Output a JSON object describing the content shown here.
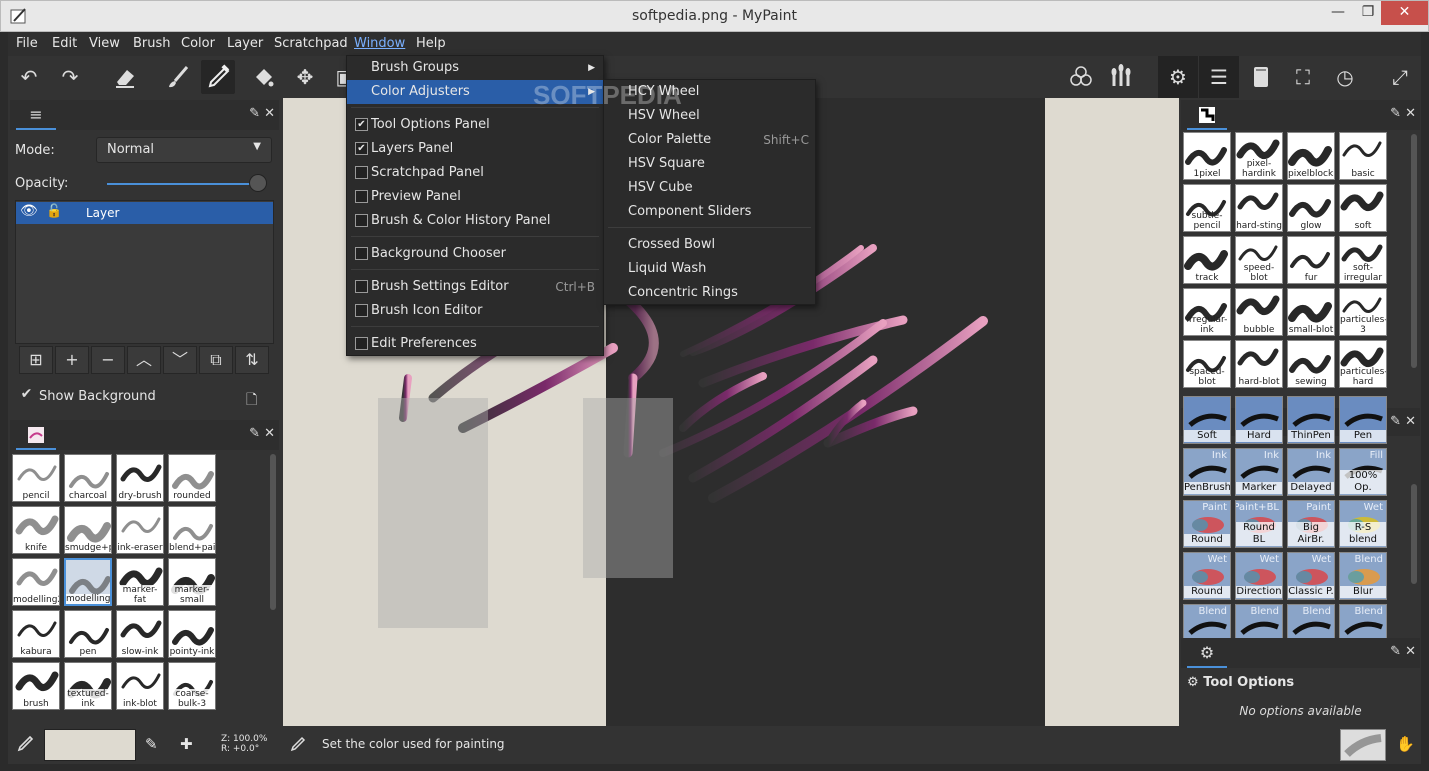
{
  "window": {
    "title": "softpedia.png - MyPaint",
    "minimize": "—",
    "maximize": "❐",
    "close": "✕"
  },
  "menubar": [
    "File",
    "Edit",
    "View",
    "Brush",
    "Color",
    "Layer",
    "Scratchpad",
    "Window",
    "Help"
  ],
  "layers_panel": {
    "mode_label": "Mode:",
    "mode_value": "Normal",
    "opacity_label": "Opacity:",
    "opacity_value": 0.97,
    "layer_name": "Layer",
    "show_background_label": "Show Background"
  },
  "left_brushes": [
    "pencil",
    "charcoal",
    "dry-brush",
    "rounded",
    "knife",
    "smudge+paint",
    "ink-eraser",
    "blend+paint",
    "modelling2",
    "modelling",
    "marker-fat",
    "marker-small",
    "kabura",
    "pen",
    "slow-ink",
    "pointy-ink",
    "brush",
    "textured-ink",
    "ink-blot",
    "coarse-bulk-3"
  ],
  "window_menu": {
    "items": [
      {
        "label": "Brush Groups",
        "submenu": true
      },
      {
        "label": "Color Adjusters",
        "submenu": true,
        "highlighted": true
      },
      {
        "label": "Tool Options Panel",
        "checked": true
      },
      {
        "label": "Layers Panel",
        "checked": true
      },
      {
        "label": "Scratchpad Panel",
        "checked": false
      },
      {
        "label": "Preview Panel",
        "checked": false
      },
      {
        "label": "Brush & Color History Panel",
        "checked": false
      },
      {
        "label": "Background Chooser",
        "checked": false
      },
      {
        "label": "Brush Settings Editor",
        "checked": false,
        "accel": "Ctrl+B"
      },
      {
        "label": "Brush Icon Editor",
        "checked": false
      },
      {
        "label": "Edit Preferences",
        "checked": false
      }
    ]
  },
  "color_adjusters_menu": [
    {
      "label": "HCY Wheel"
    },
    {
      "label": "HSV Wheel"
    },
    {
      "label": "Color Palette",
      "accel": "Shift+C"
    },
    {
      "label": "HSV Square"
    },
    {
      "label": "HSV Cube"
    },
    {
      "label": "Component Sliders"
    },
    {
      "label": "Crossed Bowl"
    },
    {
      "label": "Liquid Wash"
    },
    {
      "label": "Concentric Rings"
    }
  ],
  "watermark": "SOFTPEDIA",
  "right_brushes_top": [
    "1pixel",
    "pixel-hardink",
    "pixelblocking",
    "basic",
    "subtle-pencil",
    "hard-sting",
    "glow",
    "soft",
    "track",
    "speed-blot",
    "fur",
    "soft-irregular",
    "irregular-ink",
    "bubble",
    "small-blot",
    "particules-3",
    "spaced-blot",
    "hard-blot",
    "sewing",
    "particules-hard"
  ],
  "right_brushes_mid": [
    {
      "label": "Soft",
      "tag": ""
    },
    {
      "label": "Hard",
      "tag": ""
    },
    {
      "label": "ThinPen",
      "tag": ""
    },
    {
      "label": "Pen",
      "tag": ""
    },
    {
      "label": "PenBrush",
      "tag": "Ink"
    },
    {
      "label": "Marker",
      "tag": "Ink"
    },
    {
      "label": "Delayed",
      "tag": "Ink"
    },
    {
      "label": "100% Op.",
      "tag": "Fill"
    },
    {
      "label": "Round",
      "tag": "Paint"
    },
    {
      "label": "Round BL",
      "tag": "Paint+BL"
    },
    {
      "label": "Big AirBr.",
      "tag": "Paint"
    },
    {
      "label": "R-S blend",
      "tag": "Wet"
    },
    {
      "label": "Round",
      "tag": "Wet"
    },
    {
      "label": "Direction",
      "tag": "Wet"
    },
    {
      "label": "Classic P.",
      "tag": "Wet"
    },
    {
      "label": "Blur",
      "tag": "Blend"
    },
    {
      "label": "",
      "tag": "Blend"
    },
    {
      "label": "",
      "tag": "Blend"
    },
    {
      "label": "",
      "tag": "Blend"
    },
    {
      "label": "",
      "tag": "Blend"
    }
  ],
  "tool_options": {
    "title": "Tool Options",
    "empty": "No options available"
  },
  "statusbar": {
    "zoom": "Z: 100.0%",
    "rotation": "R: +0.0°",
    "message": "Set the color used for painting"
  },
  "colors": {
    "accent": "#2a5ea8",
    "canvas_light": "#dedad0",
    "canvas_dark": "#2d2d2d",
    "stroke_pink": "#c63a8c"
  }
}
